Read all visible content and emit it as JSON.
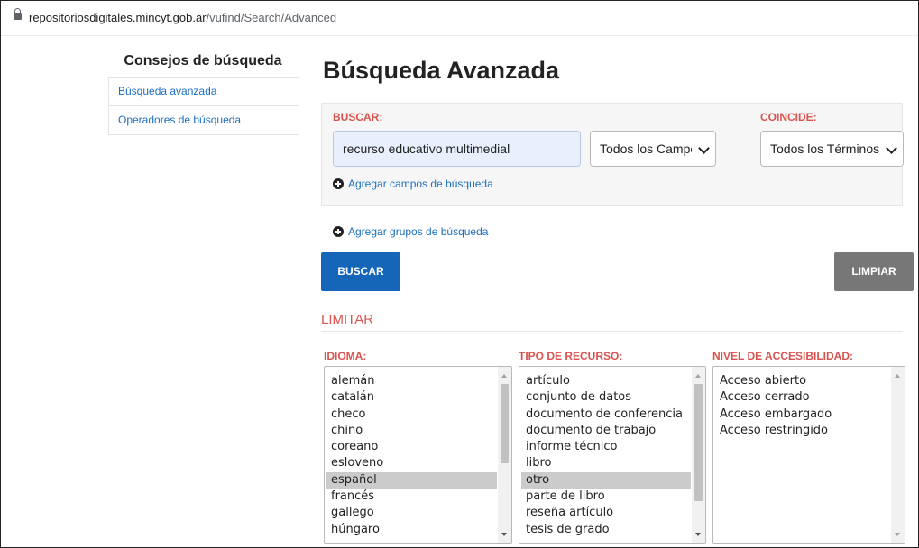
{
  "browser": {
    "url_host": "repositoriosdigitales.mincyt.gob.ar",
    "url_path": "/vufind/Search/Advanced"
  },
  "sidebar": {
    "title": "Consejos de búsqueda",
    "items": [
      {
        "label": "Búsqueda avanzada"
      },
      {
        "label": "Operadores de búsqueda"
      }
    ]
  },
  "main": {
    "title": "Búsqueda Avanzada",
    "buscar_label": "BUSCAR:",
    "coincide_label": "COINCIDE:",
    "search_value": "recurso educativo multimedial",
    "field_select": "Todos los Campos",
    "match_select": "Todos los Términos",
    "add_field": "Agregar campos de búsqueda",
    "add_group": "Agregar grupos de búsqueda",
    "search_button": "BUSCAR",
    "clear_button": "LIMPIAR"
  },
  "limitar": {
    "heading": "LIMITAR",
    "idioma": {
      "label": "IDIOMA:",
      "options": [
        "alemán",
        "catalán",
        "checo",
        "chino",
        "coreano",
        "esloveno",
        "español",
        "francés",
        "gallego",
        "húngaro"
      ],
      "selected": "español"
    },
    "tipo": {
      "label": "TIPO DE RECURSO:",
      "options": [
        "artículo",
        "conjunto de datos",
        "documento de conferencia",
        "documento de trabajo",
        "informe técnico",
        "libro",
        "otro",
        "parte de libro",
        "reseña artículo",
        "tesis de grado"
      ],
      "selected": "otro"
    },
    "nivel": {
      "label": "NIVEL DE ACCESIBILIDAD:",
      "options": [
        "Acceso abierto",
        "Acceso cerrado",
        "Acceso embargado",
        "Acceso restringido"
      ]
    }
  },
  "colors": {
    "link": "#1b6ec2",
    "accent_red": "#d9534f",
    "primary_button": "#1565b8",
    "secondary_button": "#777777"
  }
}
